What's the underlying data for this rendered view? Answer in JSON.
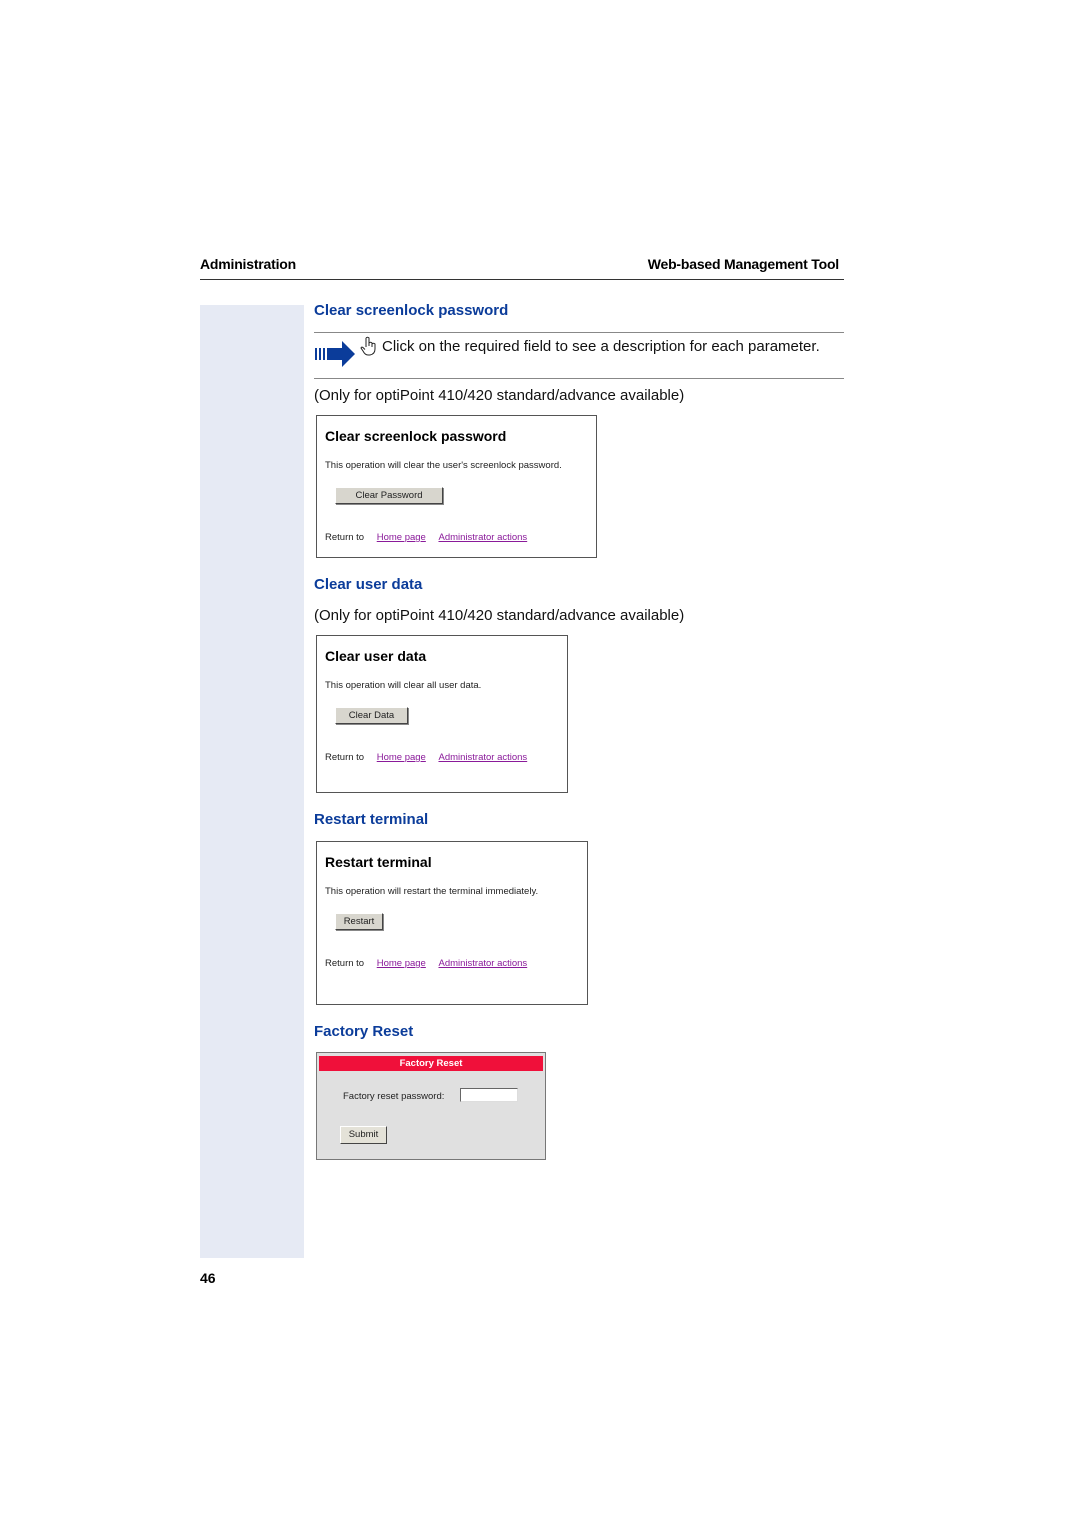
{
  "header": {
    "left": "Administration",
    "right": "Web-based Management Tool"
  },
  "note": {
    "text": "Click on the required field to see a description for each parameter."
  },
  "sections": [
    {
      "heading": "Clear screenlock password",
      "availability": "(Only for optiPoint 410/420 standard/advance available)",
      "panel": {
        "title": "Clear screenlock password",
        "description": "This operation will clear the user's screenlock password.",
        "button": "Clear Password",
        "return_label": "Return to",
        "links": [
          "Home page",
          "Administrator actions"
        ]
      }
    },
    {
      "heading": "Clear user data",
      "availability": "(Only for optiPoint 410/420 standard/advance available)",
      "panel": {
        "title": "Clear user data",
        "description": "This operation will clear all user data.",
        "button": "Clear Data",
        "return_label": "Return to",
        "links": [
          "Home page",
          "Administrator actions"
        ]
      }
    },
    {
      "heading": "Restart terminal",
      "panel": {
        "title": "Restart terminal",
        "description": "This operation will restart the terminal immediately.",
        "button": "Restart",
        "return_label": "Return to",
        "links": [
          "Home page",
          "Administrator actions"
        ]
      }
    },
    {
      "heading": "Factory Reset",
      "panel": {
        "title": "Factory Reset",
        "field_label": "Factory reset password:",
        "field_value": "",
        "button": "Submit"
      }
    }
  ],
  "colors": {
    "heading": "#0b3c9a",
    "factory_bar": "#f0103a",
    "link": "#8a1a9a",
    "sidebar": "#e6eaf4"
  },
  "page_number": "46"
}
